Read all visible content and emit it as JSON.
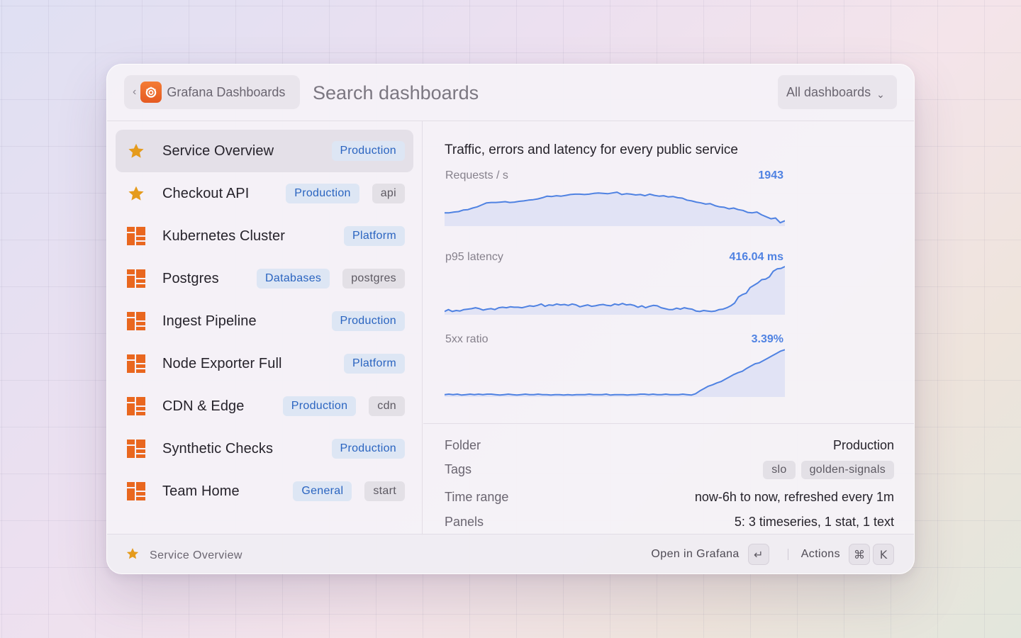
{
  "header": {
    "back_chevron": "‹",
    "extension_name": "Grafana Dashboards",
    "search_placeholder": "Search dashboards",
    "filter_dropdown": "All dashboards",
    "dropdown_chevron": "⌄"
  },
  "list": {
    "items": [
      {
        "title": "Service Overview",
        "icon": "star-icon",
        "starred": true,
        "selected": true,
        "tags": [
          {
            "label": "Production",
            "kind": "folder"
          }
        ]
      },
      {
        "title": "Checkout API",
        "icon": "star-icon",
        "starred": true,
        "selected": false,
        "tags": [
          {
            "label": "Production",
            "kind": "folder"
          },
          {
            "label": "api",
            "kind": "plain"
          }
        ]
      },
      {
        "title": "Kubernetes Cluster",
        "icon": "dashboard-icon",
        "starred": false,
        "selected": false,
        "tags": [
          {
            "label": "Platform",
            "kind": "folder"
          }
        ]
      },
      {
        "title": "Postgres",
        "icon": "dashboard-icon",
        "starred": false,
        "selected": false,
        "tags": [
          {
            "label": "Databases",
            "kind": "folder"
          },
          {
            "label": "postgres",
            "kind": "plain"
          }
        ]
      },
      {
        "title": "Ingest Pipeline",
        "icon": "dashboard-icon",
        "starred": false,
        "selected": false,
        "tags": [
          {
            "label": "Production",
            "kind": "folder"
          }
        ]
      },
      {
        "title": "Node Exporter Full",
        "icon": "dashboard-icon",
        "starred": false,
        "selected": false,
        "tags": [
          {
            "label": "Platform",
            "kind": "folder"
          }
        ]
      },
      {
        "title": "CDN & Edge",
        "icon": "dashboard-icon",
        "starred": false,
        "selected": false,
        "tags": [
          {
            "label": "Production",
            "kind": "folder"
          },
          {
            "label": "cdn",
            "kind": "plain"
          }
        ]
      },
      {
        "title": "Synthetic Checks",
        "icon": "dashboard-icon",
        "starred": false,
        "selected": false,
        "tags": [
          {
            "label": "Production",
            "kind": "folder"
          }
        ]
      },
      {
        "title": "Team Home",
        "icon": "dashboard-icon",
        "starred": false,
        "selected": false,
        "tags": [
          {
            "label": "General",
            "kind": "folder"
          },
          {
            "label": "start",
            "kind": "plain"
          }
        ]
      }
    ]
  },
  "detail": {
    "description": "Traffic, errors and latency for every public service",
    "charts": [
      {
        "label": "Requests / s",
        "value": "1943",
        "points": [
          0.3,
          0.3,
          0.32,
          0.33,
          0.37,
          0.38,
          0.42,
          0.45,
          0.5,
          0.55,
          0.56,
          0.56,
          0.57,
          0.58,
          0.56,
          0.57,
          0.59,
          0.6,
          0.62,
          0.63,
          0.65,
          0.68,
          0.72,
          0.71,
          0.73,
          0.72,
          0.74,
          0.76,
          0.77,
          0.77,
          0.76,
          0.77,
          0.79,
          0.8,
          0.79,
          0.78,
          0.8,
          0.82,
          0.76,
          0.78,
          0.77,
          0.75,
          0.76,
          0.73,
          0.77,
          0.74,
          0.72,
          0.73,
          0.7,
          0.71,
          0.68,
          0.67,
          0.62,
          0.6,
          0.57,
          0.55,
          0.52,
          0.53,
          0.48,
          0.45,
          0.44,
          0.4,
          0.42,
          0.38,
          0.36,
          0.31,
          0.3,
          0.32,
          0.25,
          0.2,
          0.15,
          0.17,
          0.05,
          0.1
        ]
      },
      {
        "label": "p95 latency",
        "value": "416.04 ms",
        "points": [
          0.04,
          0.08,
          0.04,
          0.06,
          0.05,
          0.08,
          0.09,
          0.1,
          0.12,
          0.1,
          0.07,
          0.09,
          0.1,
          0.08,
          0.12,
          0.13,
          0.12,
          0.14,
          0.13,
          0.13,
          0.12,
          0.14,
          0.16,
          0.15,
          0.17,
          0.2,
          0.15,
          0.18,
          0.17,
          0.2,
          0.18,
          0.19,
          0.17,
          0.2,
          0.18,
          0.14,
          0.16,
          0.18,
          0.15,
          0.16,
          0.18,
          0.19,
          0.17,
          0.16,
          0.2,
          0.18,
          0.21,
          0.18,
          0.19,
          0.17,
          0.13,
          0.16,
          0.12,
          0.15,
          0.17,
          0.16,
          0.12,
          0.1,
          0.08,
          0.08,
          0.11,
          0.09,
          0.12,
          0.1,
          0.09,
          0.05,
          0.04,
          0.06,
          0.05,
          0.04,
          0.05,
          0.08,
          0.09,
          0.12,
          0.16,
          0.22,
          0.35,
          0.4,
          0.43,
          0.55,
          0.6,
          0.65,
          0.72,
          0.73,
          0.78,
          0.9,
          0.95,
          0.96,
          1.0
        ]
      },
      {
        "label": "5xx ratio",
        "value": "3.39%",
        "points": [
          0.02,
          0.03,
          0.02,
          0.03,
          0.01,
          0.02,
          0.03,
          0.02,
          0.03,
          0.02,
          0.03,
          0.03,
          0.02,
          0.01,
          0.02,
          0.03,
          0.02,
          0.01,
          0.02,
          0.03,
          0.02,
          0.02,
          0.03,
          0.02,
          0.02,
          0.01,
          0.02,
          0.02,
          0.01,
          0.02,
          0.01,
          0.02,
          0.02,
          0.02,
          0.03,
          0.02,
          0.02,
          0.02,
          0.03,
          0.01,
          0.02,
          0.02,
          0.02,
          0.01,
          0.02,
          0.02,
          0.03,
          0.03,
          0.02,
          0.03,
          0.02,
          0.02,
          0.03,
          0.02,
          0.02,
          0.02,
          0.03,
          0.02,
          0.01,
          0.04,
          0.1,
          0.15,
          0.2,
          0.23,
          0.27,
          0.3,
          0.35,
          0.4,
          0.45,
          0.49,
          0.52,
          0.58,
          0.63,
          0.68,
          0.7,
          0.75,
          0.8,
          0.85,
          0.9,
          0.95,
          0.98
        ]
      }
    ],
    "meta": {
      "folder_key": "Folder",
      "folder_val": "Production",
      "tags_key": "Tags",
      "tags": [
        "slo",
        "golden-signals"
      ],
      "time_key": "Time range",
      "time_val": "now-6h to now, refreshed every 1m",
      "panels_key": "Panels",
      "panels_val": "5: 3 timeseries, 1 stat, 1 text"
    }
  },
  "footer": {
    "selected_label": "Service Overview",
    "primary_action": "Open in Grafana",
    "primary_key": "↵",
    "actions_label": "Actions",
    "actions_keys": [
      "⌘",
      "K"
    ]
  },
  "colors": {
    "accent_orange": "#e9671f",
    "star": "#e59b1c",
    "folder_tag_text": "#2a64c0",
    "chart_line": "#4f82e2",
    "chart_fill": "#dde0f4"
  }
}
